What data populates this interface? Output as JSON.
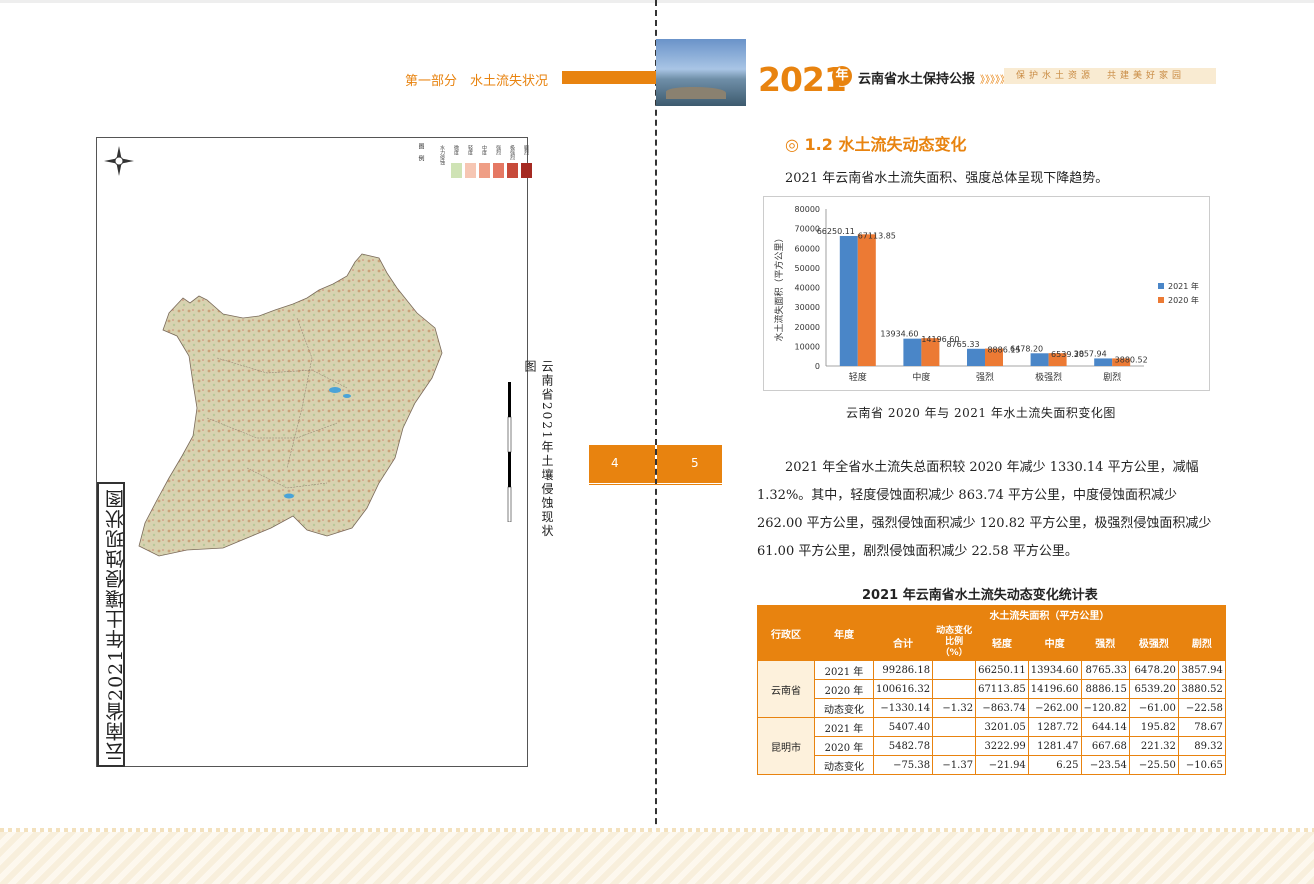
{
  "left_page": {
    "header": "第一部分　水土流失状况",
    "map_title": "云南省2021年土壤侵蚀现状图",
    "side_caption": "云南省2021年土壤侵蚀现状图",
    "legend": {
      "title": "图　例",
      "items": [
        {
          "label": "水力侵蚀",
          "color": "#ffffff"
        },
        {
          "label": "微度",
          "color": "#cfe3b5"
        },
        {
          "label": "轻度",
          "color": "#f6c6b3"
        },
        {
          "label": "中度",
          "color": "#ef9e85"
        },
        {
          "label": "强烈",
          "color": "#e57863"
        },
        {
          "label": "极强烈",
          "color": "#c74a3a"
        },
        {
          "label": "剧烈",
          "color": "#a52a22"
        }
      ]
    },
    "page_number": "4"
  },
  "right_page": {
    "header": {
      "year": "2021",
      "year_suffix": "年",
      "title": "云南省水土保持公报",
      "arrows": "》》》》》",
      "slogan": "保护水土资源　共建美好家园"
    },
    "section_title": "◎ 1.2  水土流失动态变化",
    "intro": "2021 年云南省水土流失面积、强度总体呈现下降趋势。",
    "chart_caption": "云南省 2020 年与 2021 年水土流失面积变化图",
    "paragraph": "2021 年全省水土流失总面积较 2020 年减少 1330.14 平方公里，减幅 1.32%。其中，轻度侵蚀面积减少 863.74 平方公里，中度侵蚀面积减少 262.00 平方公里，强烈侵蚀面积减少 120.82 平方公里，极强烈侵蚀面积减少 61.00 平方公里，剧烈侵蚀面积减少 22.58 平方公里。",
    "table_title": "2021 年云南省水土流失动态变化统计表",
    "table": {
      "h_region": "行政区",
      "h_year": "年度",
      "h_group": "水土流失面积（平方公里）",
      "h_cols": [
        "合计",
        "动态变化比例（%）",
        "轻度",
        "中度",
        "强烈",
        "极强烈",
        "剧烈"
      ],
      "groups": [
        {
          "region": "云南省",
          "rows": [
            [
              "2021 年",
              "99286.18",
              "",
              "66250.11",
              "13934.60",
              "8765.33",
              "6478.20",
              "3857.94"
            ],
            [
              "2020 年",
              "100616.32",
              "",
              "67113.85",
              "14196.60",
              "8886.15",
              "6539.20",
              "3880.52"
            ],
            [
              "动态变化",
              "−1330.14",
              "−1.32",
              "−863.74",
              "−262.00",
              "−120.82",
              "−61.00",
              "−22.58"
            ]
          ]
        },
        {
          "region": "昆明市",
          "rows": [
            [
              "2021 年",
              "5407.40",
              "",
              "3201.05",
              "1287.72",
              "644.14",
              "195.82",
              "78.67"
            ],
            [
              "2020 年",
              "5482.78",
              "",
              "3222.99",
              "1281.47",
              "667.68",
              "221.32",
              "89.32"
            ],
            [
              "动态变化",
              "−75.38",
              "−1.37",
              "−21.94",
              "6.25",
              "−23.54",
              "−25.50",
              "−10.65"
            ]
          ]
        }
      ]
    },
    "page_number": "5"
  },
  "chart_data": {
    "type": "bar",
    "categories": [
      "轻度",
      "中度",
      "强烈",
      "极强烈",
      "剧烈"
    ],
    "series": [
      {
        "name": "2021 年",
        "color": "#4a86c8",
        "values": [
          66250.11,
          13934.6,
          8765.33,
          6478.2,
          3857.94
        ]
      },
      {
        "name": "2020 年",
        "color": "#ec7a34",
        "values": [
          67113.85,
          14196.6,
          8886.15,
          6539.2,
          3880.52
        ]
      }
    ],
    "ylabel": "水土流失面积（平方公里）",
    "ylim": [
      0,
      80000
    ],
    "yticks": [
      0,
      10000,
      20000,
      30000,
      40000,
      50000,
      60000,
      70000,
      80000
    ],
    "data_labels": [
      [
        "66250.11",
        "13934.60",
        "8765.33",
        "6478.20",
        "3857.94"
      ],
      [
        "67113.85",
        "14196.60",
        "8886.15",
        "6539.20",
        "3880.52"
      ]
    ],
    "legend_position": "right",
    "grid": false
  }
}
